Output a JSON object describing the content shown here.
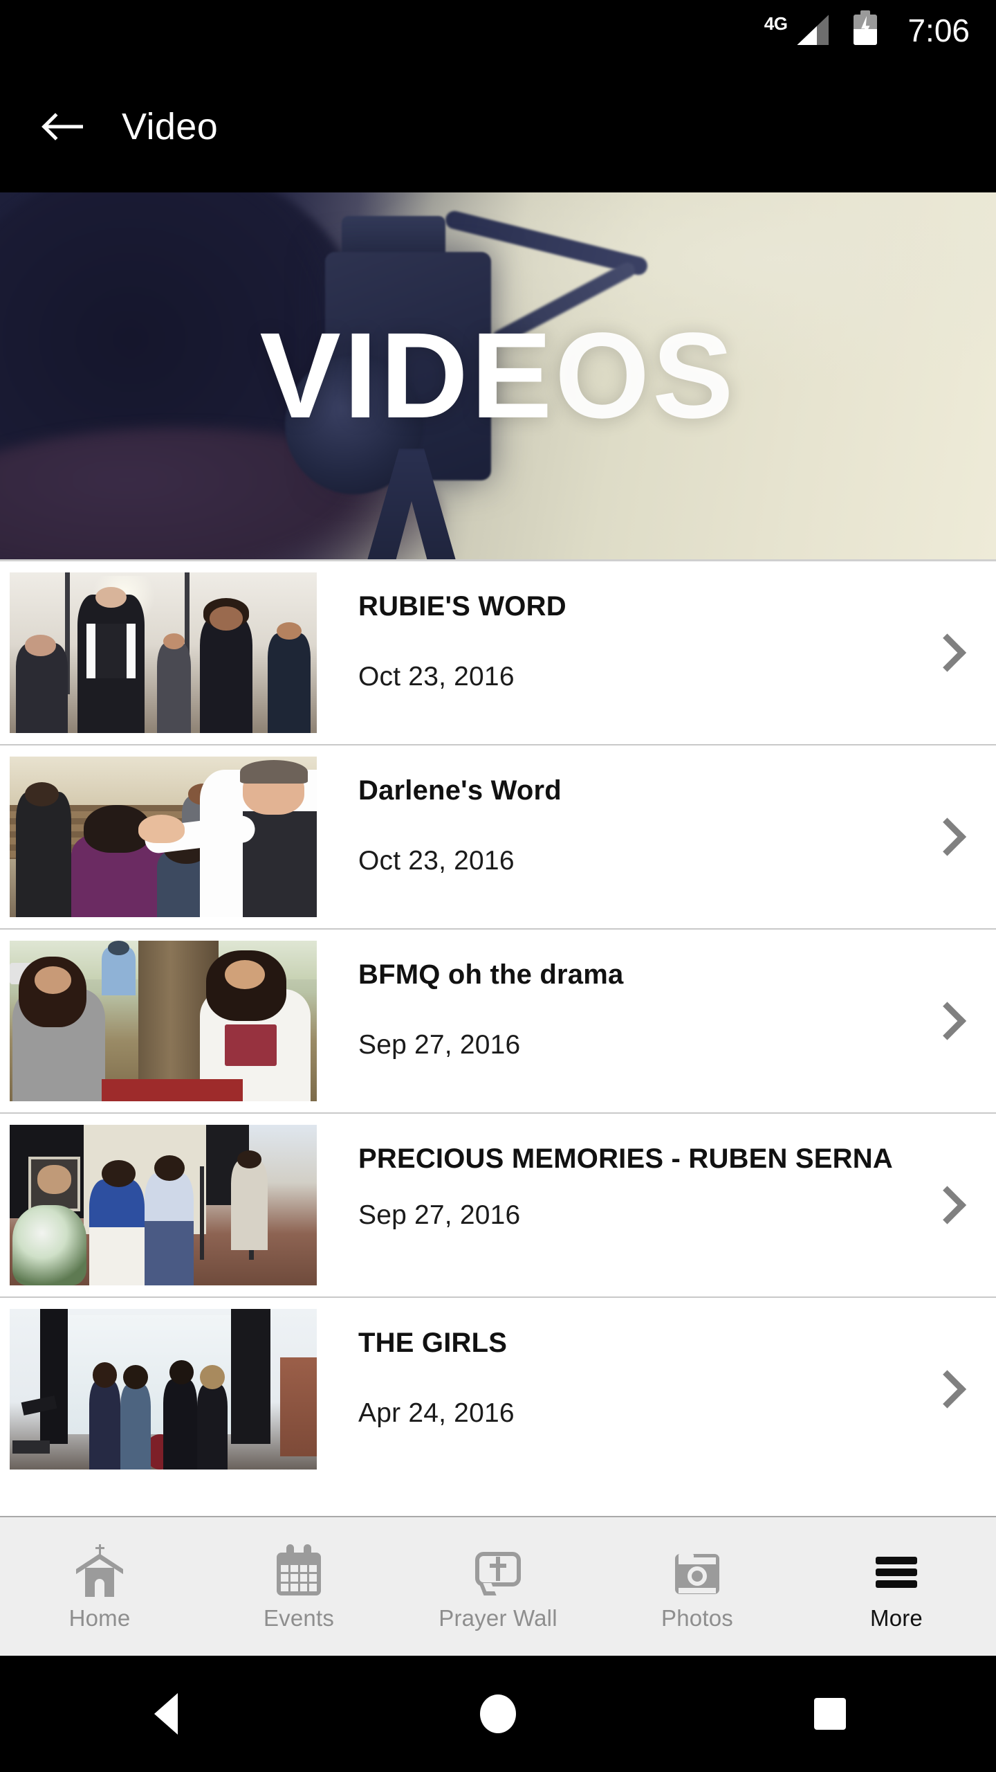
{
  "status_bar": {
    "network": "4G",
    "time": "7:06",
    "signal_icon": "signal-bars-icon",
    "battery_icon": "battery-charging-icon"
  },
  "app_bar": {
    "back_icon": "back-arrow-icon",
    "title": "Video"
  },
  "hero": {
    "title": "VIDEOS",
    "title_part_a": "VIDE",
    "title_part_b": "OS",
    "image_description": "camera-on-tripod-banner"
  },
  "videos": [
    {
      "title": "RUBIE'S WORD",
      "date": "Oct 23, 2016",
      "thumb": "church-prayer-line",
      "chevron": "chevron-right-icon"
    },
    {
      "title": "Darlene's Word",
      "date": "Oct 23, 2016",
      "thumb": "pastor-laying-hands",
      "chevron": "chevron-right-icon"
    },
    {
      "title": "BFMQ oh the drama",
      "date": "Sep 27, 2016",
      "thumb": "outdoor-girls-tree",
      "chevron": "chevron-right-icon"
    },
    {
      "title": "PRECIOUS MEMORIES - RUBEN SERNA",
      "date": "Sep 27, 2016",
      "thumb": "stage-memorial-flowers",
      "chevron": "chevron-right-icon"
    },
    {
      "title": "THE GIRLS",
      "date": "Apr 24, 2016",
      "thumb": "four-women-on-stage",
      "chevron": "chevron-right-icon"
    }
  ],
  "tab_bar": {
    "active": "More",
    "items": [
      {
        "label": "Home",
        "icon": "church-icon",
        "active": false
      },
      {
        "label": "Events",
        "icon": "calendar-icon",
        "active": false
      },
      {
        "label": "Prayer Wall",
        "icon": "prayer-bubble-icon",
        "active": false
      },
      {
        "label": "Photos",
        "icon": "camera-icon",
        "active": false
      },
      {
        "label": "More",
        "icon": "hamburger-icon",
        "active": true
      }
    ]
  },
  "android_nav": {
    "back": "nav-back-icon",
    "home": "nav-home-icon",
    "recents": "nav-recents-icon"
  },
  "colors": {
    "app_bar_bg": "#000000",
    "tab_bar_bg": "#eeeeee",
    "tab_inactive": "#8e8e8e",
    "tab_active": "#111111",
    "chevron": "#808080",
    "divider": "#c9c9c9"
  }
}
